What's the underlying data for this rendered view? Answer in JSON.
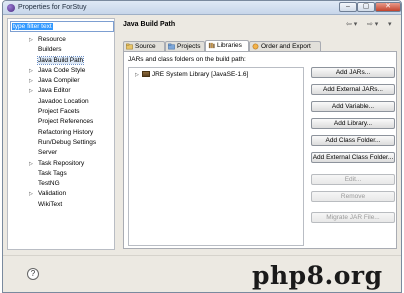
{
  "window": {
    "title": "Properties for ForStuy",
    "controls": [
      "–",
      "▢",
      "✕"
    ]
  },
  "filter": {
    "placeholder": "type filter text"
  },
  "tree": [
    {
      "label": "Resource",
      "expandable": true
    },
    {
      "label": "Builders",
      "expandable": false
    },
    {
      "label": "Java Build Path",
      "expandable": false,
      "selected": true
    },
    {
      "label": "Java Code Style",
      "expandable": true
    },
    {
      "label": "Java Compiler",
      "expandable": true
    },
    {
      "label": "Java Editor",
      "expandable": true
    },
    {
      "label": "Javadoc Location",
      "expandable": false
    },
    {
      "label": "Project Facets",
      "expandable": false
    },
    {
      "label": "Project References",
      "expandable": false
    },
    {
      "label": "Refactoring History",
      "expandable": false
    },
    {
      "label": "Run/Debug Settings",
      "expandable": false
    },
    {
      "label": "Server",
      "expandable": false
    },
    {
      "label": "Task Repository",
      "expandable": true
    },
    {
      "label": "Task Tags",
      "expandable": false
    },
    {
      "label": "TestNG",
      "expandable": false
    },
    {
      "label": "Validation",
      "expandable": true
    },
    {
      "label": "WikiText",
      "expandable": false
    }
  ],
  "page": {
    "title": "Java Build Path",
    "nav": {
      "back": "⇦ ▾",
      "forward": "⇨ ▾",
      "menu": "▾"
    },
    "tabs": {
      "source": "Source",
      "projects": "Projects",
      "libraries": "Libraries",
      "order": "Order and Export"
    },
    "panel_label": "JARs and class folders on the build path:",
    "library_item": "JRE System Library [JavaSE-1.6]",
    "buttons": {
      "add_jars": "Add JARs...",
      "add_external_jars": "Add External JARs...",
      "add_variable": "Add Variable...",
      "add_library": "Add Library...",
      "add_class_folder": "Add Class Folder...",
      "add_external_class_folder": "Add External Class Folder...",
      "edit": "Edit...",
      "remove": "Remove",
      "migrate_jar": "Migrate JAR File..."
    }
  },
  "footer": {
    "help": "?"
  },
  "watermark": "php8.org",
  "colors": {
    "selection": "#3399ff",
    "tree_selected": "#dbe7f5",
    "background": "#ece9e2"
  }
}
